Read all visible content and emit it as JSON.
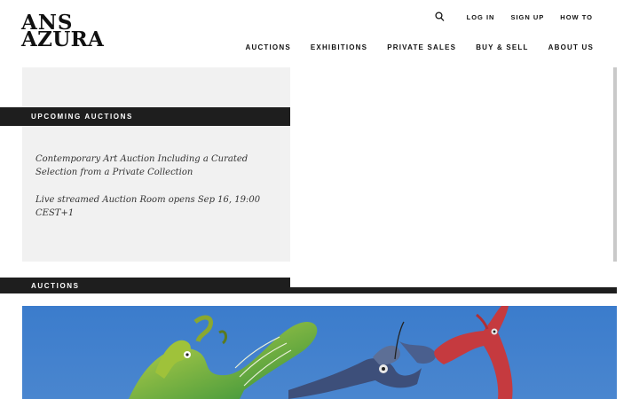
{
  "logo": {
    "line1": "ANS",
    "line2": "AZURA"
  },
  "topnav": {
    "search_icon": "search-icon",
    "items": [
      {
        "label": "LOG IN"
      },
      {
        "label": "SIGN UP"
      },
      {
        "label": "HOW TO"
      }
    ]
  },
  "mainnav": {
    "items": [
      {
        "label": "AUCTIONS"
      },
      {
        "label": "EXHIBITIONS"
      },
      {
        "label": "PRIVATE SALES"
      },
      {
        "label": "BUY & SELL"
      },
      {
        "label": "ABOUT US"
      }
    ]
  },
  "upcoming": {
    "heading": "UPCOMING AUCTIONS",
    "title": "Contemporary Art Auction Including a Curated Selection from a Private Collection",
    "subtitle": "Live streamed Auction Room opens Sep 16, 19:00 CEST+1"
  },
  "auctions": {
    "heading": "AUCTIONS"
  },
  "colors": {
    "band": "#1e1e1e",
    "panel": "#f1f1f1",
    "sky": "#3a78c8"
  }
}
